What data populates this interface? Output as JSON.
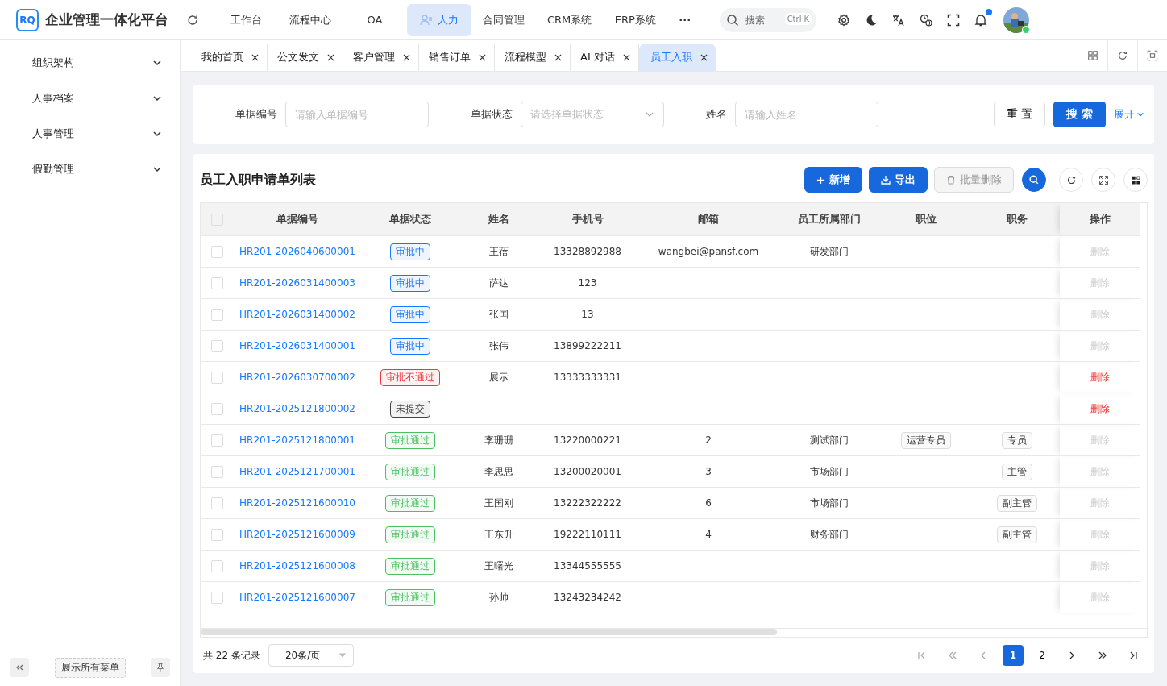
{
  "header": {
    "logo": "RQ",
    "title": "企业管理一体化平台",
    "nav": [
      {
        "label": "工作台",
        "selected": false
      },
      {
        "label": "流程中心",
        "selected": false
      },
      {
        "label": "OA",
        "selected": false
      },
      {
        "label": "人力",
        "selected": true
      },
      {
        "label": "合同管理",
        "selected": false
      },
      {
        "label": "CRM系统",
        "selected": false
      },
      {
        "label": "ERP系统",
        "selected": false
      }
    ],
    "more": "···",
    "search": {
      "placeholder": "搜索",
      "shortcut": "Ctrl K"
    },
    "unread": true
  },
  "tabs": [
    {
      "label": "我的首页",
      "selected": false
    },
    {
      "label": "公文发文",
      "selected": false
    },
    {
      "label": "客户管理",
      "selected": false
    },
    {
      "label": "销售订单",
      "selected": false
    },
    {
      "label": "流程模型",
      "selected": false
    },
    {
      "label": "AI 对话",
      "selected": false
    },
    {
      "label": "员工入职",
      "selected": true
    }
  ],
  "sidebar": {
    "items": [
      {
        "label": "组织架构",
        "expanded": false
      },
      {
        "label": "人事档案",
        "expanded": false
      },
      {
        "label": "人事管理",
        "expanded": false
      },
      {
        "label": "假勤管理",
        "expanded": false
      }
    ],
    "show_all": "展示所有菜单"
  },
  "filters": [
    {
      "label": "单据编号",
      "placeholder": "请输入单据编号",
      "kind": "input"
    },
    {
      "label": "单据状态",
      "placeholder": "请选择单据状态",
      "kind": "select"
    },
    {
      "label": "姓名",
      "placeholder": "请输入姓名",
      "kind": "input"
    }
  ],
  "filter_buttons": {
    "reset": "重 置",
    "search": "搜 索",
    "expand": "展开"
  },
  "table": {
    "title": "员工入职申请单列表",
    "add": "新增",
    "export": "导出",
    "batch_delete": "批量删除",
    "batch_delete_disabled": true,
    "all_checked": false,
    "columns": [
      "单据编号",
      "单据状态",
      "姓名",
      "手机号",
      "邮箱",
      "员工所属部门",
      "职位",
      "职务",
      "操作"
    ],
    "rows": [
      {
        "checked": false,
        "id": "HR201-2026040600001",
        "status": "审批中",
        "color": "#1677ff",
        "name": "王蓓",
        "phone": "13328892988",
        "email": "wangbei@pansf.com",
        "dept": "研发部门",
        "position": "",
        "duty": "",
        "action": "删除",
        "action_disabled": true
      },
      {
        "checked": false,
        "id": "HR201-2026031400003",
        "status": "审批中",
        "color": "#1677ff",
        "name": "萨达",
        "phone": "123",
        "email": "",
        "dept": "",
        "position": "",
        "duty": "",
        "action": "删除",
        "action_disabled": true
      },
      {
        "checked": false,
        "id": "HR201-2026031400002",
        "status": "审批中",
        "color": "#1677ff",
        "name": "张国",
        "phone": "13",
        "email": "",
        "dept": "",
        "position": "",
        "duty": "",
        "action": "删除",
        "action_disabled": true
      },
      {
        "checked": false,
        "id": "HR201-2026031400001",
        "status": "审批中",
        "color": "#1677ff",
        "name": "张伟",
        "phone": "13899222211",
        "email": "",
        "dept": "",
        "position": "",
        "duty": "",
        "action": "删除",
        "action_disabled": true
      },
      {
        "checked": false,
        "id": "HR201-2026030700002",
        "status": "审批不通过",
        "color": "#e83a3a",
        "name": "展示",
        "phone": "13333333331",
        "email": "",
        "dept": "",
        "position": "",
        "duty": "",
        "action": "删除",
        "action_disabled": false
      },
      {
        "checked": false,
        "id": "HR201-2025121800002",
        "status": "未提交",
        "color": "#444444",
        "name": "",
        "phone": "",
        "email": "",
        "dept": "",
        "position": "",
        "duty": "",
        "action": "删除",
        "action_disabled": false
      },
      {
        "checked": false,
        "id": "HR201-2025121800001",
        "status": "审批通过",
        "color": "#4cbf63",
        "name": "李珊珊",
        "phone": "13220000221",
        "email": "2",
        "dept": "测试部门",
        "position": "运营专员",
        "duty": "专员",
        "action": "删除",
        "action_disabled": true
      },
      {
        "checked": false,
        "id": "HR201-2025121700001",
        "status": "审批通过",
        "color": "#4cbf63",
        "name": "李思思",
        "phone": "13200020001",
        "email": "3",
        "dept": "市场部门",
        "position": "",
        "duty": "主管",
        "action": "删除",
        "action_disabled": true
      },
      {
        "checked": false,
        "id": "HR201-2025121600010",
        "status": "审批通过",
        "color": "#4cbf63",
        "name": "王国刚",
        "phone": "13222322222",
        "email": "6",
        "dept": "市场部门",
        "position": "",
        "duty": "副主管",
        "action": "删除",
        "action_disabled": true
      },
      {
        "checked": false,
        "id": "HR201-2025121600009",
        "status": "审批通过",
        "color": "#4cbf63",
        "name": "王东升",
        "phone": "19222110111",
        "email": "4",
        "dept": "财务部门",
        "position": "",
        "duty": "副主管",
        "action": "删除",
        "action_disabled": true
      },
      {
        "checked": false,
        "id": "HR201-2025121600008",
        "status": "审批通过",
        "color": "#4cbf63",
        "name": "王曙光",
        "phone": "13344555555",
        "email": "",
        "dept": "",
        "position": "",
        "duty": "",
        "action": "删除",
        "action_disabled": true
      },
      {
        "checked": false,
        "id": "HR201-2025121600007",
        "status": "审批通过",
        "color": "#4cbf63",
        "name": "孙帅",
        "phone": "13243234242",
        "email": "",
        "dept": "",
        "position": "",
        "duty": "",
        "action": "删除",
        "action_disabled": true
      }
    ]
  },
  "pagination": {
    "total": "共 22 条记录",
    "page_size": "20条/页",
    "pages": [
      {
        "label": "1",
        "selected": true
      },
      {
        "label": "2",
        "selected": false
      }
    ]
  }
}
